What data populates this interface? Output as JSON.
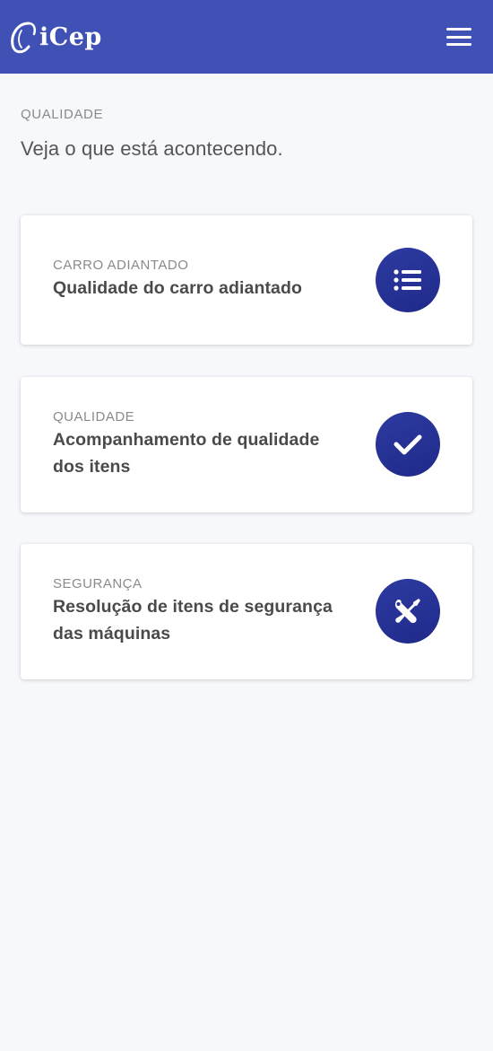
{
  "header": {
    "logo_text": "iCep",
    "menu_icon": "hamburger-menu-icon",
    "background_color": "#3f51b5"
  },
  "page": {
    "section_label": "QUALIDADE",
    "subtitle": "Veja o que está acontecendo."
  },
  "cards": [
    {
      "kicker": "CARRO ADIANTADO",
      "title": "Qualidade do carro adiantado",
      "icon": "list-icon"
    },
    {
      "kicker": "QUALIDADE",
      "title": "Acompanhamento de qualidade dos itens",
      "icon": "check-icon"
    },
    {
      "kicker": "SEGURANÇA",
      "title": "Resolução de itens de segurança das máquinas",
      "icon": "tools-icon"
    }
  ],
  "colors": {
    "accent": "#3f51b5",
    "icon_circle": "#24308f",
    "background": "#f7f8fb"
  }
}
